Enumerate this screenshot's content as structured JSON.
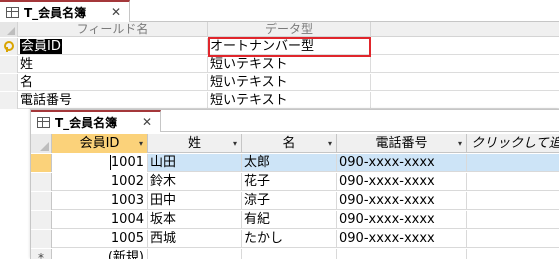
{
  "design": {
    "tab_title": "T_会員名簿",
    "close_glyph": "✕",
    "headers": {
      "field_name": "フィールド名",
      "data_type": "データ型"
    },
    "fields": [
      {
        "name": "会員ID",
        "type": "オートナンバー型",
        "primary_key": true
      },
      {
        "name": "姓",
        "type": "短いテキスト"
      },
      {
        "name": "名",
        "type": "短いテキスト"
      },
      {
        "name": "電話番号",
        "type": "短いテキスト"
      }
    ]
  },
  "datasheet": {
    "tab_title": "T_会員名簿",
    "close_glyph": "✕",
    "columns": [
      "会員ID",
      "姓",
      "名",
      "電話番号",
      "クリックして追加"
    ],
    "dropdown_glyph": "▾",
    "rows": [
      {
        "id": "1001",
        "sei": "山田",
        "mei": "太郎",
        "tel": "090-xxxx-xxxx"
      },
      {
        "id": "1002",
        "sei": "鈴木",
        "mei": "花子",
        "tel": "090-xxxx-xxxx"
      },
      {
        "id": "1003",
        "sei": "田中",
        "mei": "涼子",
        "tel": "090-xxxx-xxxx"
      },
      {
        "id": "1004",
        "sei": "坂本",
        "mei": "有紀",
        "tel": "090-xxxx-xxxx"
      },
      {
        "id": "1005",
        "sei": "西城",
        "mei": "たかし",
        "tel": "090-xxxx-xxxx"
      }
    ],
    "new_row": {
      "marker": "*",
      "label": "(新規)"
    }
  },
  "colors": {
    "highlight_border": "#e0262c",
    "active_header": "#fbd27a",
    "current_row": "#cde4f7",
    "tab_accent": "#a4373a"
  }
}
